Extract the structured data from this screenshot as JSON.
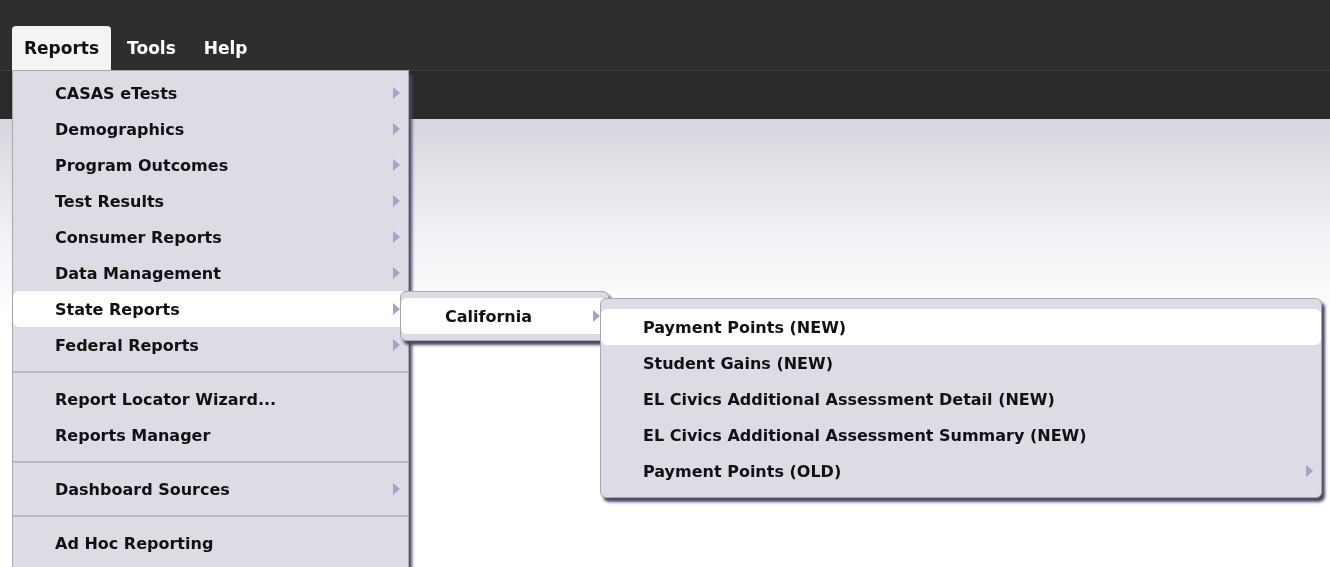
{
  "menubar": [
    {
      "label": "Reports",
      "selected": true
    },
    {
      "label": "Tools",
      "selected": false
    },
    {
      "label": "Help",
      "selected": false
    }
  ],
  "reports_menu": [
    {
      "kind": "item",
      "label": "CASAS eTests",
      "submenu": true,
      "selected": false
    },
    {
      "kind": "item",
      "label": "Demographics",
      "submenu": true,
      "selected": false
    },
    {
      "kind": "item",
      "label": "Program Outcomes",
      "submenu": true,
      "selected": false
    },
    {
      "kind": "item",
      "label": "Test Results",
      "submenu": true,
      "selected": false
    },
    {
      "kind": "item",
      "label": "Consumer Reports",
      "submenu": true,
      "selected": false
    },
    {
      "kind": "item",
      "label": "Data Management",
      "submenu": true,
      "selected": false
    },
    {
      "kind": "item",
      "label": "State Reports",
      "submenu": true,
      "selected": true
    },
    {
      "kind": "item",
      "label": "Federal Reports",
      "submenu": true,
      "selected": false
    },
    {
      "kind": "separator"
    },
    {
      "kind": "item",
      "label": "Report Locator Wizard...",
      "submenu": false,
      "selected": false
    },
    {
      "kind": "item",
      "label": "Reports Manager",
      "submenu": false,
      "selected": false
    },
    {
      "kind": "separator"
    },
    {
      "kind": "item",
      "label": "Dashboard Sources",
      "submenu": true,
      "selected": false
    },
    {
      "kind": "separator"
    },
    {
      "kind": "item",
      "label": "Ad Hoc Reporting",
      "submenu": false,
      "selected": false
    }
  ],
  "state_menu": [
    {
      "kind": "item",
      "label": "California",
      "submenu": true,
      "selected": true
    }
  ],
  "california_menu": [
    {
      "kind": "item",
      "label": "Payment Points (NEW)",
      "submenu": false,
      "selected": true
    },
    {
      "kind": "item",
      "label": "Student Gains (NEW)",
      "submenu": false,
      "selected": false
    },
    {
      "kind": "item",
      "label": "EL Civics Additional Assessment Detail (NEW)",
      "submenu": false,
      "selected": false
    },
    {
      "kind": "item",
      "label": "EL Civics Additional Assessment Summary (NEW)",
      "submenu": false,
      "selected": false
    },
    {
      "kind": "item",
      "label": "Payment Points (OLD)",
      "submenu": true,
      "selected": false
    }
  ]
}
